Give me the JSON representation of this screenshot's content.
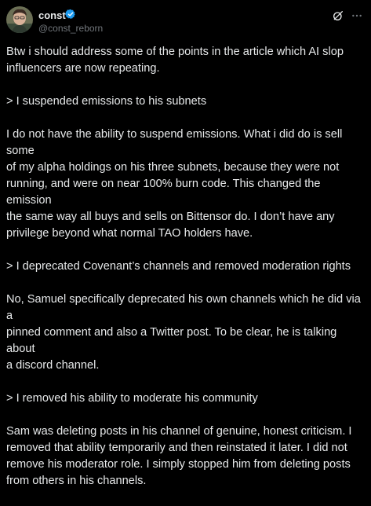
{
  "author": {
    "display_name": "const",
    "handle": "@const_reborn",
    "verified_icon": "verified-badge-icon",
    "avatar": "avatar-icon"
  },
  "header_icons": {
    "grok": "grok-icon",
    "more": "more-options-icon"
  },
  "paragraphs": [
    "Btw i should address some of the points in the article which AI slop\ninfluencers are now repeating.",
    "> I suspended emissions to his subnets",
    "I do not have the ability to suspend emissions. What i did do is sell some\nof my alpha holdings on his three subnets, because they were not\nrunning, and were on near 100% burn code. This changed the emission\nthe same way all buys and sells on Bittensor do. I don’t have any\nprivilege beyond what normal TAO holders have.",
    "> I deprecated Covenant’s channels and removed moderation rights",
    "No, Samuel specifically deprecated his own channels which he did via a\npinned comment and also a Twitter post. To be clear, he is talking about\na discord channel.",
    "> I removed his ability to moderate his community",
    "Sam was deleting posts in his channel of genuine, honest criticism. I\nremoved that ability temporarily and then reinstated it later. I did not\nremove his moderator role. I simply stopped him from deleting posts\nfrom others in his channels."
  ],
  "colors": {
    "background": "#000000",
    "text": "#e7e9ea",
    "secondary": "#71767b",
    "verified": "#1d9bf0"
  }
}
